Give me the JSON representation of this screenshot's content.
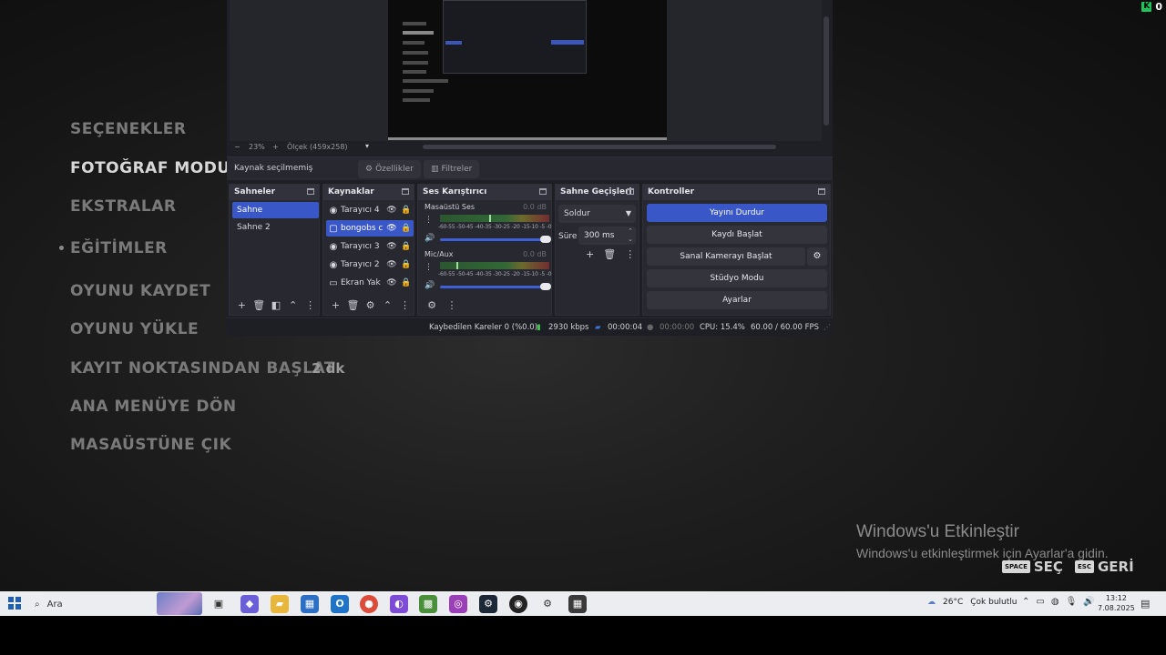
{
  "game": {
    "menu_items": [
      "SEÇENEKLER",
      "FOTOĞRAF MODU",
      "EKSTRALAR",
      "EĞİTİMLER",
      "OYUNU KAYDET",
      "OYUNU YÜKLE",
      "KAYIT NOKTASINDAN BAŞLAT",
      "ANA MENÜYE DÖN",
      "MASAÜSTÜNE ÇIK"
    ],
    "active_item": "FOTOĞRAF MODU",
    "checkpoint_time": "2 dk",
    "hints": [
      {
        "key": "SPACE",
        "label": "SEÇ"
      },
      {
        "key": "ESC",
        "label": "GERİ"
      }
    ],
    "top_badge": {
      "letter": "K",
      "value": "0"
    }
  },
  "windows_activation": {
    "title": "Windows'u Etkinleştir",
    "subtitle": "Windows'u etkinleştirmek için Ayarlar'a gidin."
  },
  "obs": {
    "preview": {
      "zoom": "23%",
      "scale_label": "Ölçek (459x258)",
      "zoom_minus": "−",
      "zoom_plus": "+"
    },
    "source_bar": {
      "no_source": "Kaynak seçilmemiş",
      "properties": "Özellikler",
      "filters": "Filtreler"
    },
    "scenes": {
      "title": "Sahneler",
      "items": [
        "Sahne",
        "Sahne 2"
      ],
      "selected": 0
    },
    "sources": {
      "title": "Kaynaklar",
      "items": [
        {
          "name": "Tarayıcı 4",
          "icon": "globe-icon",
          "glyph": "◉"
        },
        {
          "name": "bongobs c",
          "icon": "file-icon",
          "glyph": "▢"
        },
        {
          "name": "Tarayıcı 3",
          "icon": "globe-icon",
          "glyph": "◉"
        },
        {
          "name": "Tarayıcı 2",
          "icon": "globe-icon",
          "glyph": "◉"
        },
        {
          "name": "Ekran Yak",
          "icon": "monitor-icon",
          "glyph": "▭"
        }
      ],
      "selected": 1
    },
    "mixer": {
      "title": "Ses Karıştırıcı",
      "channels": [
        {
          "name": "Masaüstü Ses",
          "db": "0.0 dB",
          "scale": "-60-55 -50-45 -40-35 -30-25 -20 -15-10 -5 -0",
          "level": 0.45,
          "volume": 1.0
        },
        {
          "name": "Mic/Aux",
          "db": "0.0 dB",
          "scale": "-60-55 -50-45 -40-35 -30-25 -20 -15-10 -5 -0",
          "level": 0.15,
          "volume": 1.0
        }
      ]
    },
    "transitions": {
      "title": "Sahne Geçişleri",
      "type": "Soldur",
      "duration_label": "Süre",
      "duration": "300 ms"
    },
    "controls": {
      "title": "Kontroller",
      "stop_stream": "Yayını Durdur",
      "start_record": "Kaydı Başlat",
      "start_virtualcam": "Sanal Kamerayı Başlat",
      "studio_mode": "Stüdyo Modu",
      "settings": "Ayarlar"
    },
    "status": {
      "dropped_frames": "Kaybedilen Kareler 0 (%0.0)",
      "bitrate": "2930 kbps",
      "stream_time": "00:00:04",
      "record_time": "00:00:00",
      "cpu": "CPU: 15.4%",
      "fps": "60.00 / 60.00 FPS"
    }
  },
  "taskbar": {
    "search_placeholder": "Ara",
    "weather_temp": "26°C",
    "weather_text": "Çok bulutlu",
    "time": "13:12",
    "date": "7.08.2025",
    "colors": {
      "start": "#1f5fae",
      "obs_blue": "#3a57c7"
    }
  }
}
